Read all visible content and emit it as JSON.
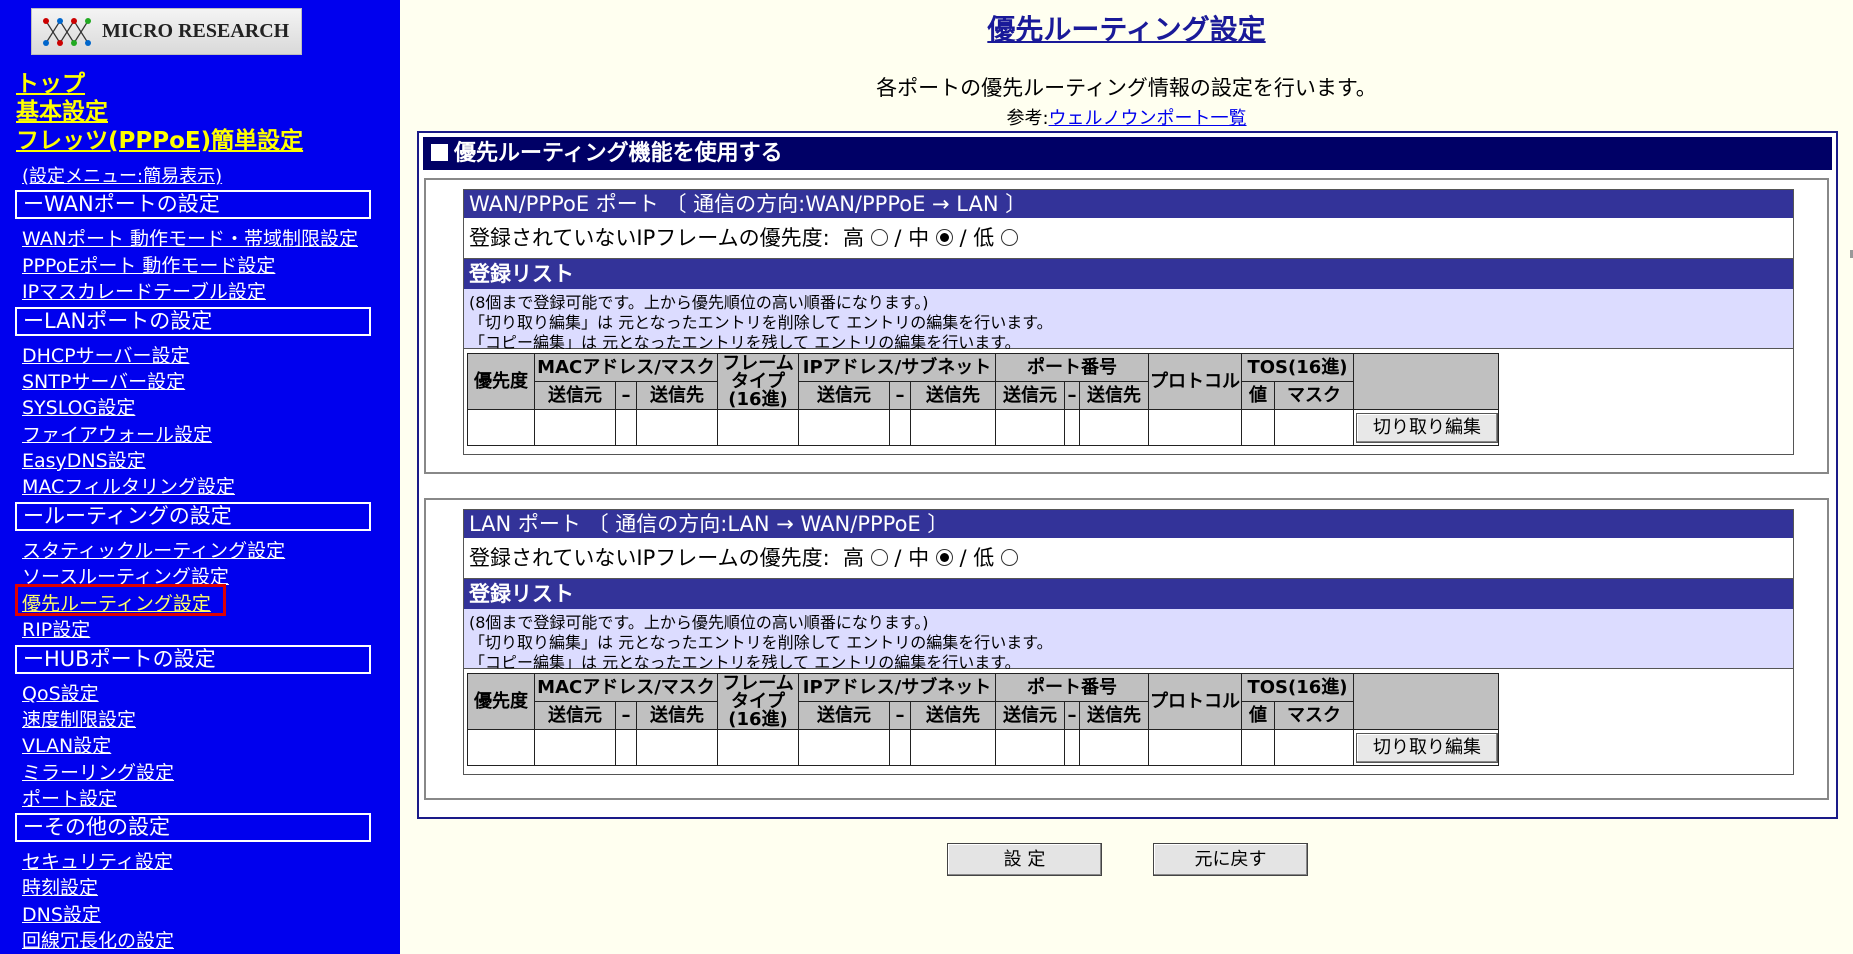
{
  "sidebar": {
    "logo_text": "MICRO RESEARCH",
    "top_links": [
      "トップ",
      "基本設定",
      "フレッツ(PPPoE)簡単設定"
    ],
    "menu_mode_link": "(設定メニュー:簡易表示)",
    "sections": [
      {
        "title": "ーWANポートの設定",
        "items": [
          "WANポート 動作モード・帯域制限設定",
          "PPPoEポート 動作モード設定",
          "IPマスカレードテーブル設定"
        ]
      },
      {
        "title": "ーLANポートの設定",
        "items": [
          "DHCPサーバー設定",
          "SNTPサーバー設定",
          "SYSLOG設定",
          "ファイアウォール設定",
          "EasyDNS設定",
          "MACフィルタリング設定"
        ]
      },
      {
        "title": "ールーティングの設定",
        "items": [
          "スタティックルーティング設定",
          "ソースルーティング設定",
          "優先ルーティング設定",
          "RIP設定"
        ]
      },
      {
        "title": "ーHUBポートの設定",
        "items": [
          "QoS設定",
          "速度制限設定",
          "VLAN設定",
          "ミラーリング設定",
          "ポート設定"
        ]
      },
      {
        "title": "ーその他の設定",
        "items": [
          "セキュリティ設定",
          "時刻設定",
          "DNS設定",
          "回線冗長化の設定"
        ]
      }
    ]
  },
  "main": {
    "title": "優先ルーティング設定",
    "description": "各ポートの優先ルーティング情報の設定を行います。",
    "reference_prefix": "参考:",
    "reference_link": "ウェルノウンポート一覧",
    "enable_label": "優先ルーティング機能を使用する",
    "ports": [
      {
        "header": "WAN/PPPoE ポート 〔 通信の方向:WAN/PPPoE → LAN 〕",
        "priority_label": "登録されていないIPフレームの優先度:",
        "priority_options": [
          "高",
          "中",
          "低"
        ],
        "priority_selected": "中",
        "list_title": "登録リスト",
        "notes": [
          "(8個まで登録可能です。上から優先順位の高い順番になります。)",
          "「切り取り編集」は 元となったエントリを削除して エントリの編集を行います。",
          "「コピー編集」は 元となったエントリを残して エントリの編集を行います。"
        ],
        "cut_button": "切り取り編集"
      },
      {
        "header": "LAN ポート 〔 通信の方向:LAN → WAN/PPPoE 〕",
        "priority_label": "登録されていないIPフレームの優先度:",
        "priority_options": [
          "高",
          "中",
          "低"
        ],
        "priority_selected": "中",
        "list_title": "登録リスト",
        "notes": [
          "(8個まで登録可能です。上から優先順位の高い順番になります。)",
          "「切り取り編集」は 元となったエントリを削除して エントリの編集を行います。",
          "「コピー編集」は 元となったエントリを残して エントリの編集を行います。"
        ],
        "cut_button": "切り取り編集"
      }
    ],
    "table_headers": {
      "priority": "優先度",
      "mac": "MACアドレス/マスク",
      "frame_type": [
        "フレーム",
        "タイプ",
        "(16進)"
      ],
      "ip": "IPアドレス/サブネット",
      "port_number": "ポート番号",
      "protocol": "プロトコル",
      "tos": "TOS(16進)",
      "src": "送信元",
      "dash": "–",
      "dst": "送信先",
      "value": "値",
      "mask": "マスク"
    },
    "buttons": {
      "apply": "設 定",
      "revert": "元に戻す"
    }
  }
}
